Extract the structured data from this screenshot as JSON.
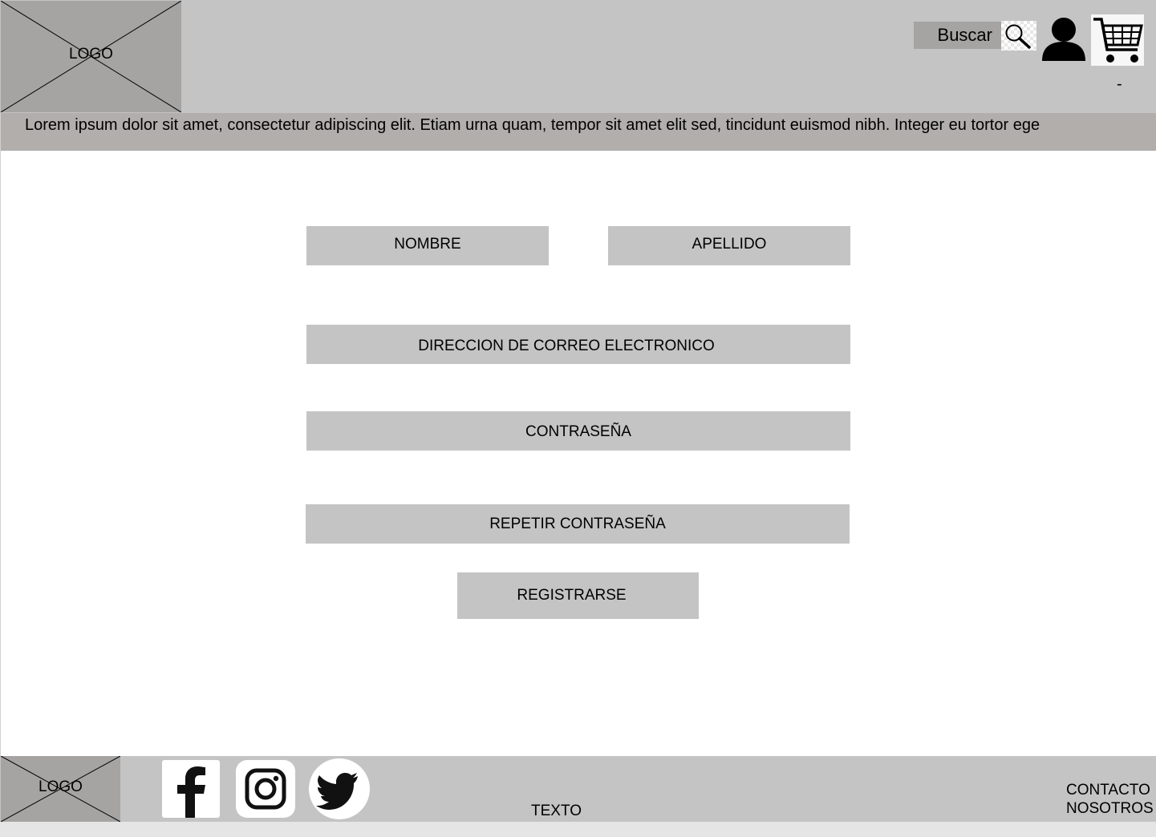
{
  "header": {
    "logo_text": "LOGO",
    "search_label": "Buscar",
    "cart_count": "-"
  },
  "banner": {
    "text": "Lorem ipsum dolor sit amet, consectetur adipiscing elit. Etiam urna quam, tempor sit amet elit sed, tincidunt euismod nibh. Integer eu tortor ege"
  },
  "form": {
    "first_name": "NOMBRE",
    "last_name": "APELLIDO",
    "email": "DIRECCION DE CORREO ELECTRONICO",
    "password": "CONTRASEÑA",
    "repeat_password": "REPETIR CONTRASEÑA",
    "submit": "REGISTRARSE"
  },
  "footer": {
    "logo_text": "LOGO",
    "text": "TEXTO",
    "links": [
      "CONTACTO",
      "NOSOTROS"
    ],
    "social_icons": [
      "facebook-icon",
      "instagram-icon",
      "twitter-icon"
    ]
  }
}
